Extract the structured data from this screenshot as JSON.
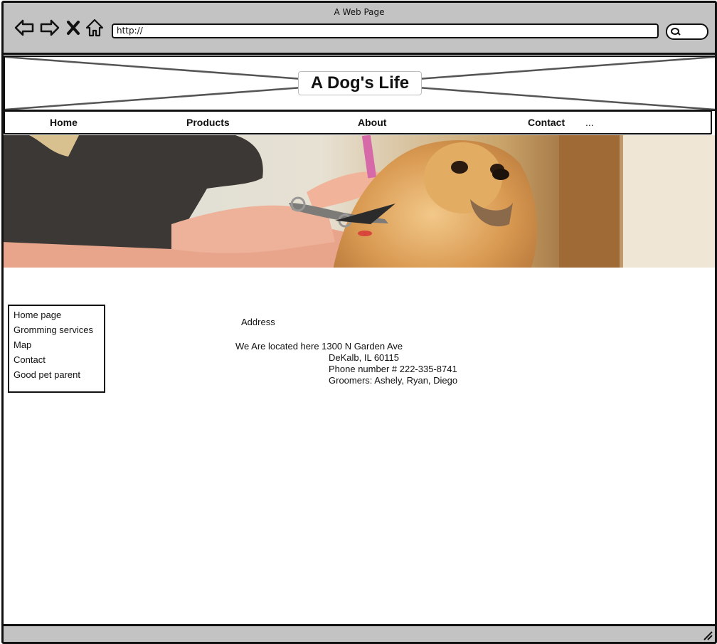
{
  "window": {
    "title": "A Web Page",
    "url": "http://"
  },
  "toolbar": {
    "icons": [
      "back-arrow-icon",
      "forward-arrow-icon",
      "close-icon",
      "home-icon",
      "search-icon"
    ]
  },
  "header": {
    "site_title": "A Dog's Life"
  },
  "nav": {
    "items": [
      {
        "label": "Home"
      },
      {
        "label": "Products"
      },
      {
        "label": "About"
      },
      {
        "label": "Contact"
      },
      {
        "label": "..."
      }
    ]
  },
  "hero": {
    "icon": "dog-grooming-photo"
  },
  "sidebar": {
    "items": [
      {
        "label": "Home page"
      },
      {
        "label": "Gromming services"
      },
      {
        "label": "Map"
      },
      {
        "label": "Contact"
      },
      {
        "label": "Good pet parent"
      }
    ]
  },
  "main": {
    "address_heading": "Address",
    "address_line1": "We Are located here 1300 N Garden Ave",
    "address_line2": "DeKalb, IL 60115",
    "phone": "Phone number # 222-335-8741",
    "groomers": "Groomers: Ashely, Ryan, Diego"
  },
  "colors": {
    "chrome_gray": "#c3c3c3",
    "border": "#111111",
    "page_bg": "#ffffff"
  }
}
